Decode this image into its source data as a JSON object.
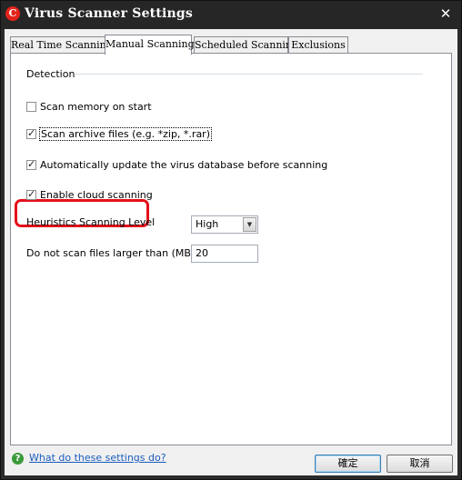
{
  "window": {
    "title": "Virus Scanner Settings",
    "app_icon_glyph": "C",
    "close_glyph": "✕"
  },
  "tabs": [
    {
      "label": "Real Time Scanning",
      "active": false
    },
    {
      "label": "Manual Scanning",
      "active": true
    },
    {
      "label": "Scheduled Scanning",
      "active": false
    },
    {
      "label": "Exclusions",
      "active": false
    }
  ],
  "detection": {
    "group_label": "Detection",
    "options": [
      {
        "label": "Scan memory on start",
        "checked": false
      },
      {
        "label": "Scan archive files (e.g. *zip, *.rar)",
        "checked": true
      },
      {
        "label": "Automatically update the virus database before scanning",
        "checked": true
      },
      {
        "label": "Enable cloud scanning",
        "checked": true
      }
    ]
  },
  "heuristics": {
    "label": "Heuristics Scanning Level",
    "value": "High"
  },
  "size_limit": {
    "label": "Do not scan files larger than (MB)",
    "value": "20"
  },
  "footer": {
    "help_icon_glyph": "?",
    "help_link": "What do these settings do?",
    "ok_label": "確定",
    "cancel_label": "取消"
  },
  "colors": {
    "highlight": "#e4101a",
    "titlebar": "#262626",
    "link": "#1a5dbe"
  },
  "icons": {
    "app": "comodo-logo-icon",
    "close": "close-icon",
    "help": "help-icon",
    "dropdown": "chevron-down-icon"
  }
}
